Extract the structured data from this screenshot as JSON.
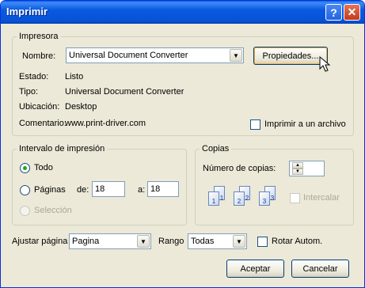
{
  "window": {
    "title": "Imprimir"
  },
  "printer": {
    "legend": "Impresora",
    "name_label": "Nombre:",
    "name_value": "Universal Document Converter",
    "properties_button": "Propiedades...",
    "status_label": "Estado:",
    "status_value": "Listo",
    "type_label": "Tipo:",
    "type_value": "Universal Document Converter",
    "location_label": "Ubicación:",
    "location_value": "Desktop",
    "comment_label": "Comentario:",
    "comment_value": "www.print-driver.com",
    "print_to_file_label": "Imprimir a un archivo"
  },
  "range": {
    "legend": "Intervalo de impresión",
    "all_label": "Todo",
    "pages_label": "Páginas",
    "from_label": "de:",
    "from_value": "18",
    "to_label": "a:",
    "to_value": "18",
    "selection_label": "Selección",
    "selected": "all"
  },
  "copies": {
    "legend": "Copias",
    "count_label": "Número de copias:",
    "count_value": "1",
    "collate_label": "Intercalar",
    "collate_checked": false,
    "collate_enabled": false,
    "page_icons": [
      "1",
      "1",
      "2",
      "2",
      "3",
      "3"
    ]
  },
  "bottom": {
    "fit_label": "Ajustar página",
    "fit_value": "Pagina",
    "range_label": "Rango",
    "range_value": "Todas",
    "auto_rotate_label": "Rotar Autom.",
    "ok_button": "Aceptar",
    "cancel_button": "Cancelar"
  }
}
